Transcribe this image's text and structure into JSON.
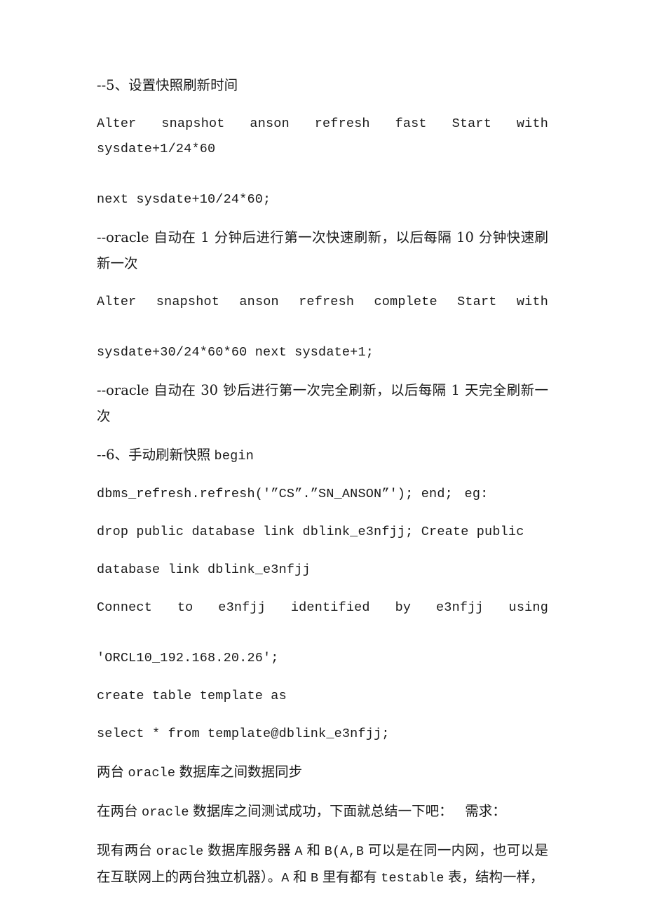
{
  "document": {
    "background_color": "#ffffff",
    "text_color": "#1a1a1a",
    "blocks": {
      "b1_heading_5": "--5、设置快照刷新时间",
      "b2_code_line1": "Alter snapshot anson  refresh fast Start with sysdate+1/24*60",
      "b2_code_line2": "next sysdate+10/24*60;",
      "b3_note_fast": "--oracle 自动在 1 分钟后进行第一次快速刷新，以后每隔 10 分钟快速刷新一次",
      "b4_code_line1": "Alter snapshot anson refresh complete Start with",
      "b4_code_line2": "sysdate+30/24*60*60 next sysdate+1;",
      "b5_note_complete": "--oracle 自动在 30 钞后进行第一次完全刷新，以后每隔 1 天完全刷新一次",
      "b6_heading_6_cn": "--6、手动刷新快照",
      "b6_heading_6_kw": "begin",
      "b7_dbms_refresh": "dbms_refresh.refresh('”CS”.”SN_ANSON”'); end;",
      "b7_eg": "eg:",
      "b8_drop_create": "drop public database link dblink_e3nfjj; Create public",
      "b9_database_link": "database link dblink_e3nfjj",
      "b10_connect_line1": "Connect to e3nfjj identified by e3nfjj using",
      "b10_connect_line2": "'ORCL10_192.168.20.26';",
      "b11_create_table": "create table template as",
      "b12_select": "select * from template@dblink_e3nfjj;",
      "b13_title_cn_a": "两台",
      "b13_title_kw": "oracle",
      "b13_title_cn_b": "数据库之间数据同步",
      "b14_intro_a": "在两台",
      "b14_intro_kw": "oracle",
      "b14_intro_b": "数据库之间测试成功，下面就总结一下吧：",
      "b14_intro_c": "需求：",
      "b15_req_a": "现有两台",
      "b15_req_kw1": "oracle",
      "b15_req_b": "数据库服务器",
      "b15_req_kw2": "A",
      "b15_req_c": "和",
      "b15_req_kw3": "B(A,B",
      "b15_req_d": "可以是在同一内网，也可以是在互联网上的两台独立机器）。",
      "b15_req_kw4": "A",
      "b15_req_e": "和",
      "b15_req_kw5": "B",
      "b15_req_f": "里有都有",
      "b15_req_kw6": "testable",
      "b15_req_g": "表，结构一样，"
    }
  }
}
